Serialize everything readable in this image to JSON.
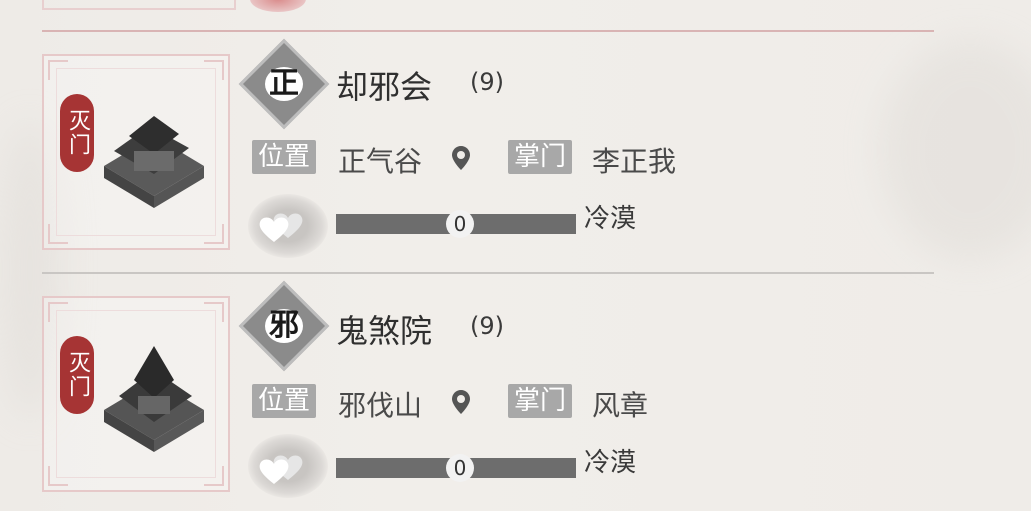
{
  "sects": [
    {
      "status": "灭门",
      "alignment": "正",
      "name": "却邪会",
      "level": "(9)",
      "location_label": "位置",
      "location": "正气谷",
      "leader_label": "掌门",
      "leader": "李正我",
      "favor": "0",
      "favor_fraction": 0.0,
      "attitude": "冷漠"
    },
    {
      "status": "灭门",
      "alignment": "邪",
      "name": "鬼煞院",
      "level": "(9)",
      "location_label": "位置",
      "location": "邪伐山",
      "leader_label": "掌门",
      "leader": "风章",
      "favor": "0",
      "favor_fraction": 0.0,
      "attitude": "冷漠"
    }
  ],
  "icons": {
    "location": "map-pin-icon",
    "favor": "hearts-icon",
    "building": "sect-building-icon"
  },
  "colors": {
    "status_tag": "#a63434",
    "label_bg": "#a8a8a8",
    "bar": "#6d6d6d",
    "divider_active": "#d9b4b4"
  }
}
